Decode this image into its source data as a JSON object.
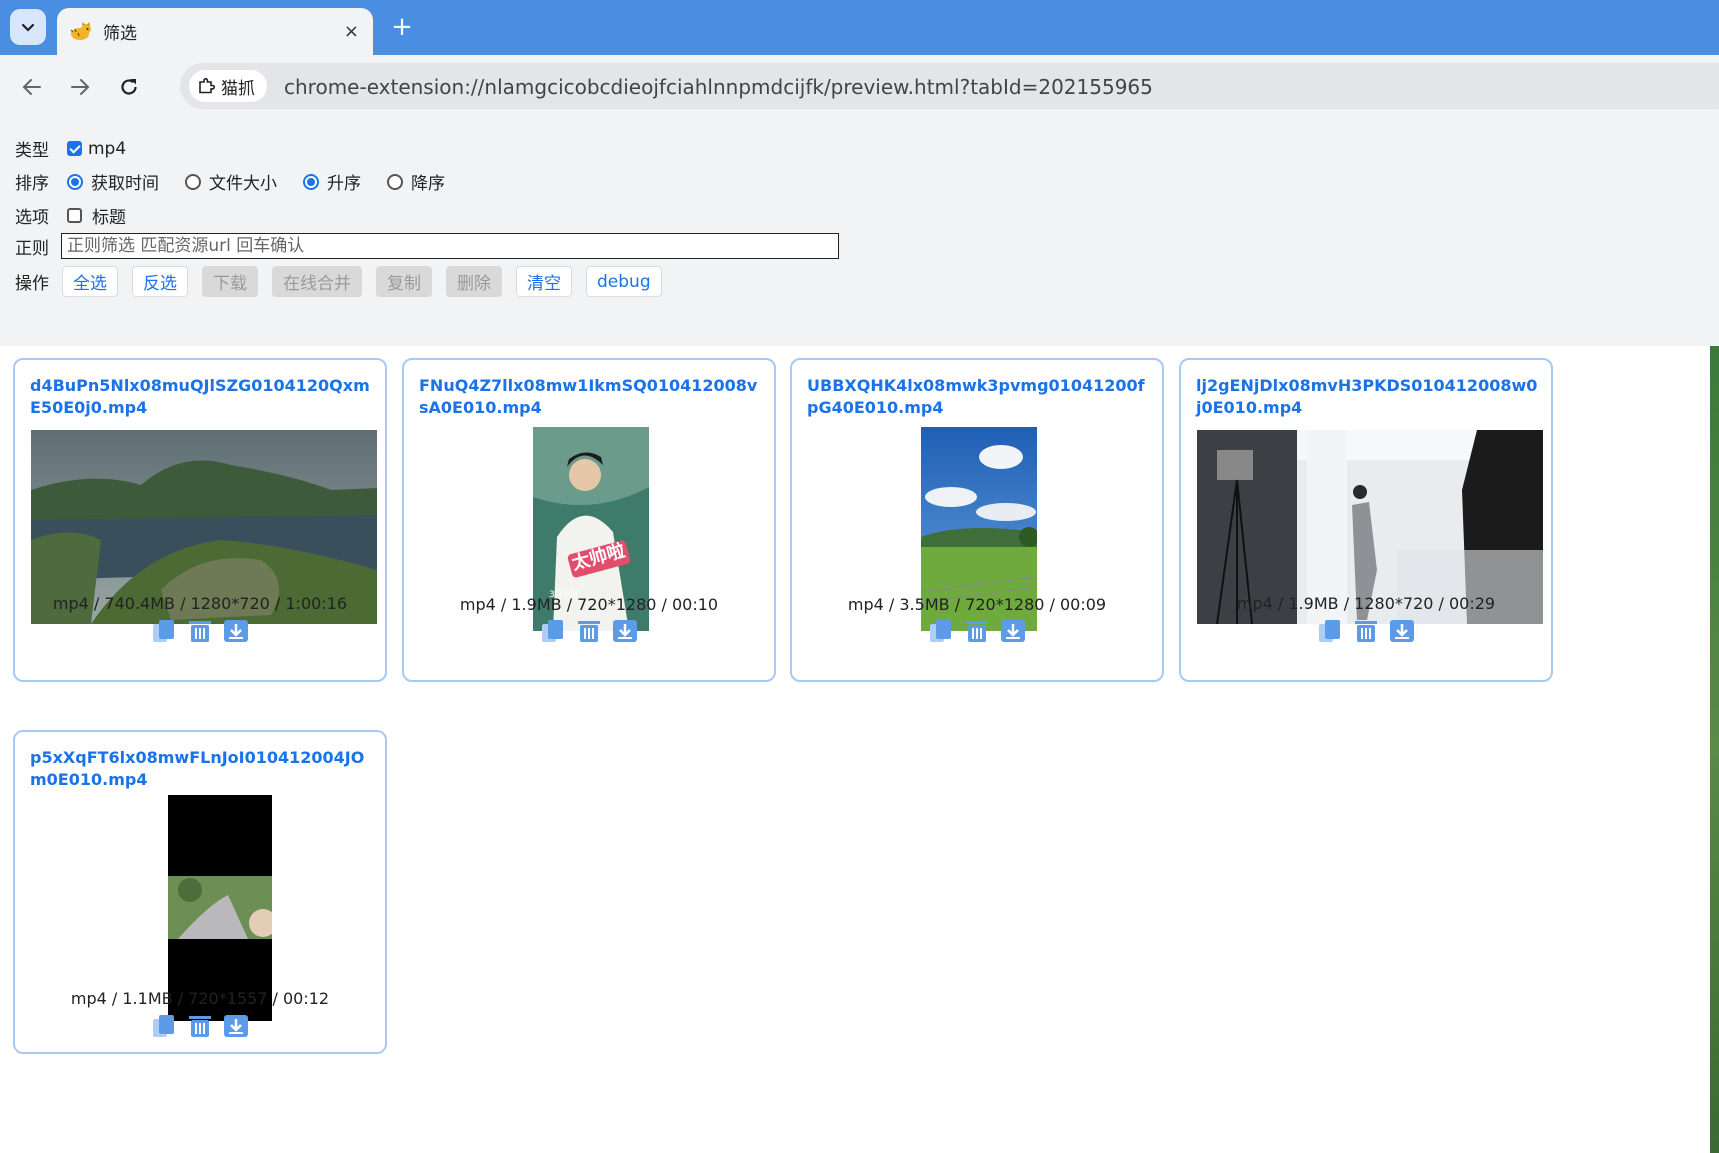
{
  "tab": {
    "title": "筛选",
    "close": "×",
    "new_tab": "+"
  },
  "toolbar": {
    "site_chip": "猫抓",
    "url": "chrome-extension://nlamgcicobcdieojfciahlnnpmdcijfk/preview.html?tabId=202155965"
  },
  "filters": {
    "type_label": "类型",
    "type_options": [
      {
        "label": "mp4",
        "checked": true
      }
    ],
    "sort_label": "排序",
    "sort_by": [
      {
        "label": "获取时间",
        "checked": true
      },
      {
        "label": "文件大小",
        "checked": false
      }
    ],
    "order": [
      {
        "label": "升序",
        "checked": true
      },
      {
        "label": "降序",
        "checked": false
      }
    ],
    "option_label": "选项",
    "options": [
      {
        "label": "标题",
        "checked": false
      }
    ],
    "regex_label": "正则",
    "regex_placeholder": "正则筛选 匹配资源url 回车确认",
    "regex_value": "",
    "actions_label": "操作",
    "actions": [
      {
        "label": "全选",
        "enabled": true
      },
      {
        "label": "反选",
        "enabled": true
      },
      {
        "label": "下载",
        "enabled": false
      },
      {
        "label": "在线合并",
        "enabled": false
      },
      {
        "label": "复制",
        "enabled": false
      },
      {
        "label": "删除",
        "enabled": false
      },
      {
        "label": "清空",
        "enabled": true
      },
      {
        "label": "debug",
        "enabled": true
      }
    ]
  },
  "media": [
    {
      "name": "d4BuPn5Nlx08muQJlSZG0104120QxmE50E0j0.mp4",
      "info": "mp4 / 740.4MB / 1280*720 / 1:00:16",
      "thumb": "landscape-island"
    },
    {
      "name": "FNuQ4Z7llx08mw1IkmSQ010412008vsA0E010.mp4",
      "info": "mp4 / 1.9MB / 720*1280 / 00:10",
      "thumb": "portrait-man"
    },
    {
      "name": "UBBXQHK4lx08mwk3pvmg01041200fpG40E010.mp4",
      "info": "mp4 / 3.5MB / 720*1280 / 00:09",
      "thumb": "portrait-meadow"
    },
    {
      "name": "lj2gENjDlx08mvH3PKDS010412008w0j0E010.mp4",
      "info": "mp4 / 1.9MB / 1280*720 / 00:29",
      "thumb": "landscape-studio"
    },
    {
      "name": "p5xXqFT6lx08mwFLnJoI010412004JOm0E010.mp4",
      "info": "mp4 / 1.1MB / 720*1557 / 00:12",
      "thumb": "portrait-letterbox"
    }
  ],
  "thumb_overlays": {
    "caption_1": "太帅啦",
    "caption_2": "3月8日"
  },
  "icons": {
    "copy": "copy-icon",
    "delete": "trash-icon",
    "download": "download-icon"
  }
}
